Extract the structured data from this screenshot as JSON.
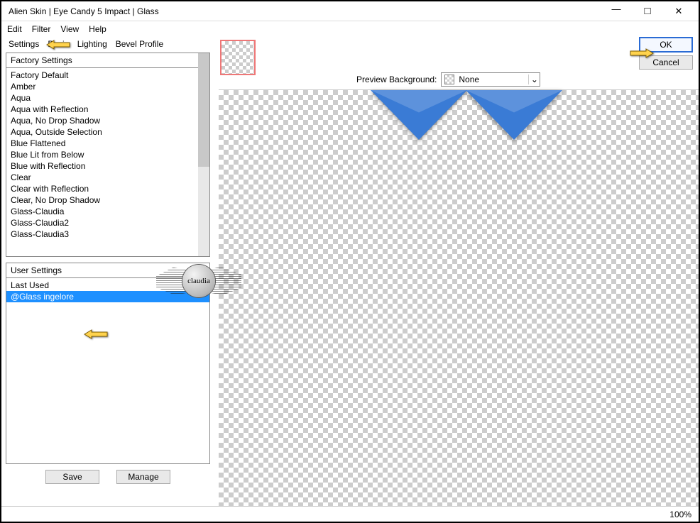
{
  "window": {
    "title": "Alien Skin | Eye Candy 5 Impact | Glass"
  },
  "menu": {
    "edit": "Edit",
    "filter": "Filter",
    "view": "View",
    "help": "Help"
  },
  "tabs": {
    "settings": "Settings",
    "basic": "Basic",
    "lighting": "Lighting",
    "bevel": "Bevel Profile"
  },
  "factory": {
    "header": "Factory Settings",
    "items": [
      "Factory Default",
      "Amber",
      "Aqua",
      "Aqua with Reflection",
      "Aqua, No Drop Shadow",
      "Aqua, Outside Selection",
      "Blue Flattened",
      "Blue Lit from Below",
      "Blue with Reflection",
      "Clear",
      "Clear with Reflection",
      "Clear, No Drop Shadow",
      "Glass-Claudia",
      "Glass-Claudia2",
      "Glass-Claudia3"
    ]
  },
  "user": {
    "header": "User Settings",
    "items": [
      "Last Used",
      "@Glass ingelore"
    ],
    "selected_index": 1
  },
  "buttons": {
    "save": "Save",
    "manage": "Manage",
    "ok": "OK",
    "cancel": "Cancel"
  },
  "preview": {
    "label": "Preview Background:",
    "value": "None"
  },
  "status": {
    "zoom": "100%"
  },
  "watermark": {
    "text": "claudia"
  }
}
